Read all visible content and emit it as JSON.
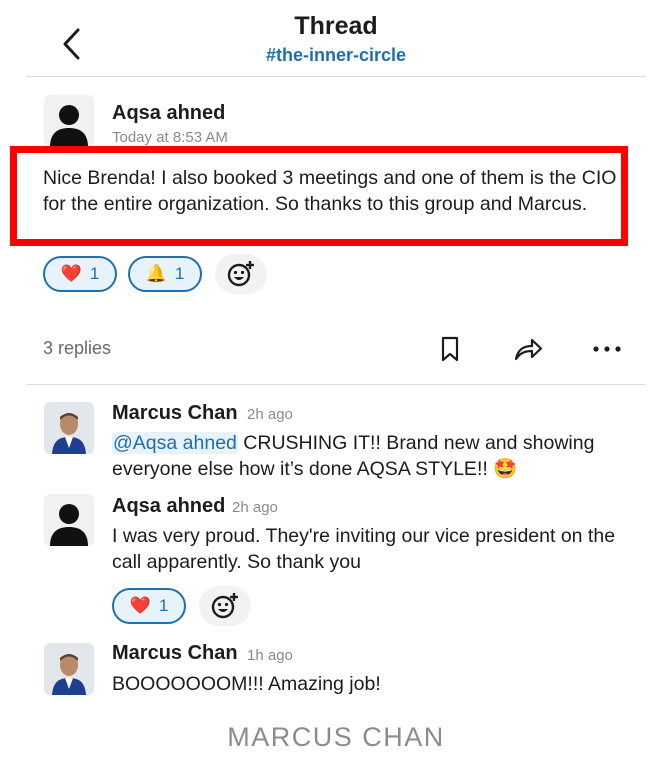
{
  "header": {
    "title": "Thread",
    "channel": "#the-inner-circle"
  },
  "parent_message": {
    "author": "Aqsa ahned",
    "timestamp": "Today at 8:53 AM",
    "text": "Nice Brenda! I also booked 3 meetings and one of them is the CIO for the entire organization. So thanks to this group and Marcus.",
    "reactions": [
      {
        "emoji": "❤️",
        "icon": "heart-icon",
        "count": "1"
      },
      {
        "emoji": "🔔",
        "icon": "bell-icon",
        "count": "1"
      }
    ]
  },
  "replies_count": "3 replies",
  "colors": {
    "accent": "#1f6fb0",
    "highlight_border": "#ff0000"
  },
  "replies": [
    {
      "author": "Marcus Chan",
      "time": "2h ago",
      "mention": "@Aqsa ahned",
      "text": " CRUSHING IT!! Brand new and showing everyone else how it’s done AQSA STYLE!! 🤩"
    },
    {
      "author": "Aqsa ahned",
      "time": "2h ago",
      "text": "I was very proud. They're inviting our vice president on the call apparently. So thank you",
      "reactions": [
        {
          "emoji": "❤️",
          "icon": "heart-icon",
          "count": "1"
        }
      ]
    },
    {
      "author": "Marcus Chan",
      "time": "1h ago",
      "text": "BOOOOOOOM!!! Amazing job!"
    }
  ],
  "watermark": "MARCUS CHAN"
}
